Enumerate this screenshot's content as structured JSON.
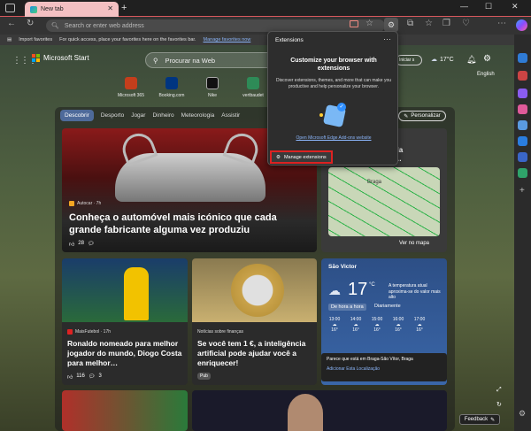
{
  "browser": {
    "tab_title": "New tab",
    "new_tab_icon": "+",
    "address_placeholder": "Search or enter web address",
    "favorites_bar": {
      "import": "Import favorites",
      "message": "For quick access, place your favorites here on the favorites bar.",
      "manage_link": "Manage favorites now"
    }
  },
  "extensions_popup": {
    "title": "Extensions",
    "heading": "Customize your browser with extensions",
    "description": "Discover extensions, themes, and more that can make you productive and help personalize your browser.",
    "link": "Open Microsoft Edge Add-ons website",
    "manage_label": "Manage extensions"
  },
  "start_page": {
    "brand": "Microsoft Start",
    "search_placeholder": "Procurar na Web",
    "signin_label": "Iniciar s",
    "weather_temp": "17°C",
    "language": "English",
    "quick_links": [
      {
        "label": "Microsoft 365",
        "color": "#c43e1c"
      },
      {
        "label": "Booking.com",
        "color": "#003580"
      },
      {
        "label": "Nike",
        "color": "#111111"
      },
      {
        "label": "vertbaudet",
        "color": "#2e8b57"
      },
      {
        "label": "",
        "color": "#cc2222"
      }
    ],
    "nav": [
      "Descobrir",
      "Desporto",
      "Jogar",
      "Dinheiro",
      "Meteorologia",
      "Assistir"
    ],
    "personalize": "Personalizar",
    "feedback": "Feedback"
  },
  "cards": {
    "hero": {
      "source": "Autocar · 7h",
      "title": "Conheça o automóvel mais icónico que cada grande fabricante alguma vez produziu",
      "likes": "28"
    },
    "traffic": {
      "title_partial": "fechada\nda de…",
      "city": "Braga",
      "link": "Ver no mapa"
    },
    "soccer": {
      "source": "MaisFutebol · 17h",
      "title": "Ronaldo nomeado para melhor jogador do mundo, Diogo Costa para melhor…",
      "likes": "116",
      "comments": "3"
    },
    "finance": {
      "source": "Notícias sobre finanças",
      "title": "Se você tem 1 €, a inteligência artificial pode ajudar você a enriquecer!",
      "tag": "Pub"
    },
    "weather": {
      "location": "São Victor",
      "temp": "17",
      "unit": "°C",
      "note": "A temperatura atual aproxima-se do valor mais alto",
      "tab_hourly": "De hora a hora",
      "tab_daily": "Diariamente",
      "forecast": [
        {
          "time": "13:00",
          "temp": "16°"
        },
        {
          "time": "14:00",
          "temp": "16°"
        },
        {
          "time": "15:00",
          "temp": "16°"
        },
        {
          "time": "16:00",
          "temp": "16°"
        },
        {
          "time": "17:00",
          "temp": "16°"
        }
      ],
      "location_prompt": "Parece que está em Braga-São Vítor, Braga",
      "location_link": "Adicionar Esta Localização"
    }
  }
}
